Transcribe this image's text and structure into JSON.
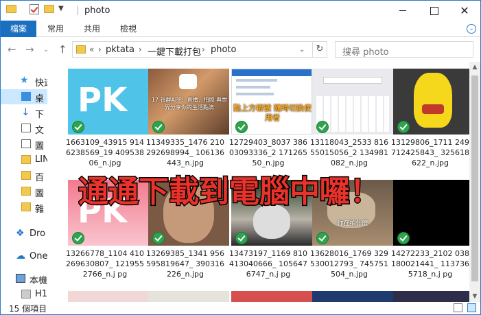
{
  "window": {
    "title": "photo"
  },
  "ribbon": {
    "tabs": [
      "檔案",
      "常用",
      "共用",
      "檢視"
    ]
  },
  "address": {
    "overflow": "«",
    "crumbs": [
      "pktata",
      "一鍵下載打包",
      "photo"
    ]
  },
  "search": {
    "placeholder": "搜尋 photo"
  },
  "nav_pane": {
    "items": [
      {
        "label": "快速",
        "icon": "star-icon"
      },
      {
        "label": "桌",
        "icon": "desktop-icon"
      },
      {
        "label": "下",
        "icon": "download-icon"
      },
      {
        "label": "文",
        "icon": "document-icon"
      },
      {
        "label": "圖",
        "icon": "pictures-icon"
      },
      {
        "label": "LIN",
        "icon": "folder-icon"
      },
      {
        "label": "百",
        "icon": "folder-icon"
      },
      {
        "label": "圖",
        "icon": "folder-icon"
      },
      {
        "label": "雜",
        "icon": "folder-icon"
      },
      {
        "label": "Dro",
        "icon": "dropbox-icon"
      },
      {
        "label": "One",
        "icon": "onedrive-icon"
      },
      {
        "label": "本機",
        "icon": "computer-icon"
      },
      {
        "label": "H1",
        "icon": "disk-icon"
      }
    ]
  },
  "files": [
    {
      "name": "1663109_43915 9146238569_19 40953806_n.jpg",
      "thumb_label": "PK"
    },
    {
      "name": "11349335_1476 210292698994_ 106136443_n.jpg",
      "thumb_label": "17 社群APP！直播．拍照 與世界分享你的生活點滴"
    },
    {
      "name": "12729403_8037 38603093336_2 17126550_n.jpg",
      "thumb_label": "點上方帳號 隨時切換使用者"
    },
    {
      "name": "13118043_2533 81655015056_2 134981082_n.jpg",
      "thumb_label": ""
    },
    {
      "name": "13129806_1711 249712425843_ 325618622_n.jpg",
      "thumb_label": ""
    },
    {
      "name": "13266778_1104 410269630807_ 1219552766_n.j pg",
      "thumb_label": "PK"
    },
    {
      "name": "13269385_1341 956595819647_ 390316226_n.jpg",
      "thumb_label": ""
    },
    {
      "name": "13473197_1169 810413040666_ 1056476747_n.j pg",
      "thumb_label": ""
    },
    {
      "name": "13628016_1769 329530012793_ 745751504_n.jpg",
      "thumb_label": "你在拍什麼"
    },
    {
      "name": "14272233_2102 038180021441_ 1137365718_n.j pg",
      "thumb_label": ""
    }
  ],
  "overlay": {
    "text": "通通下載到電腦中囉！"
  },
  "status": {
    "count": "15 個項目"
  },
  "colors": {
    "accent": "#1a6fc0",
    "check": "#2ea44f",
    "overlay_fill": "#e8322a",
    "overlay_stroke": "#000000"
  }
}
